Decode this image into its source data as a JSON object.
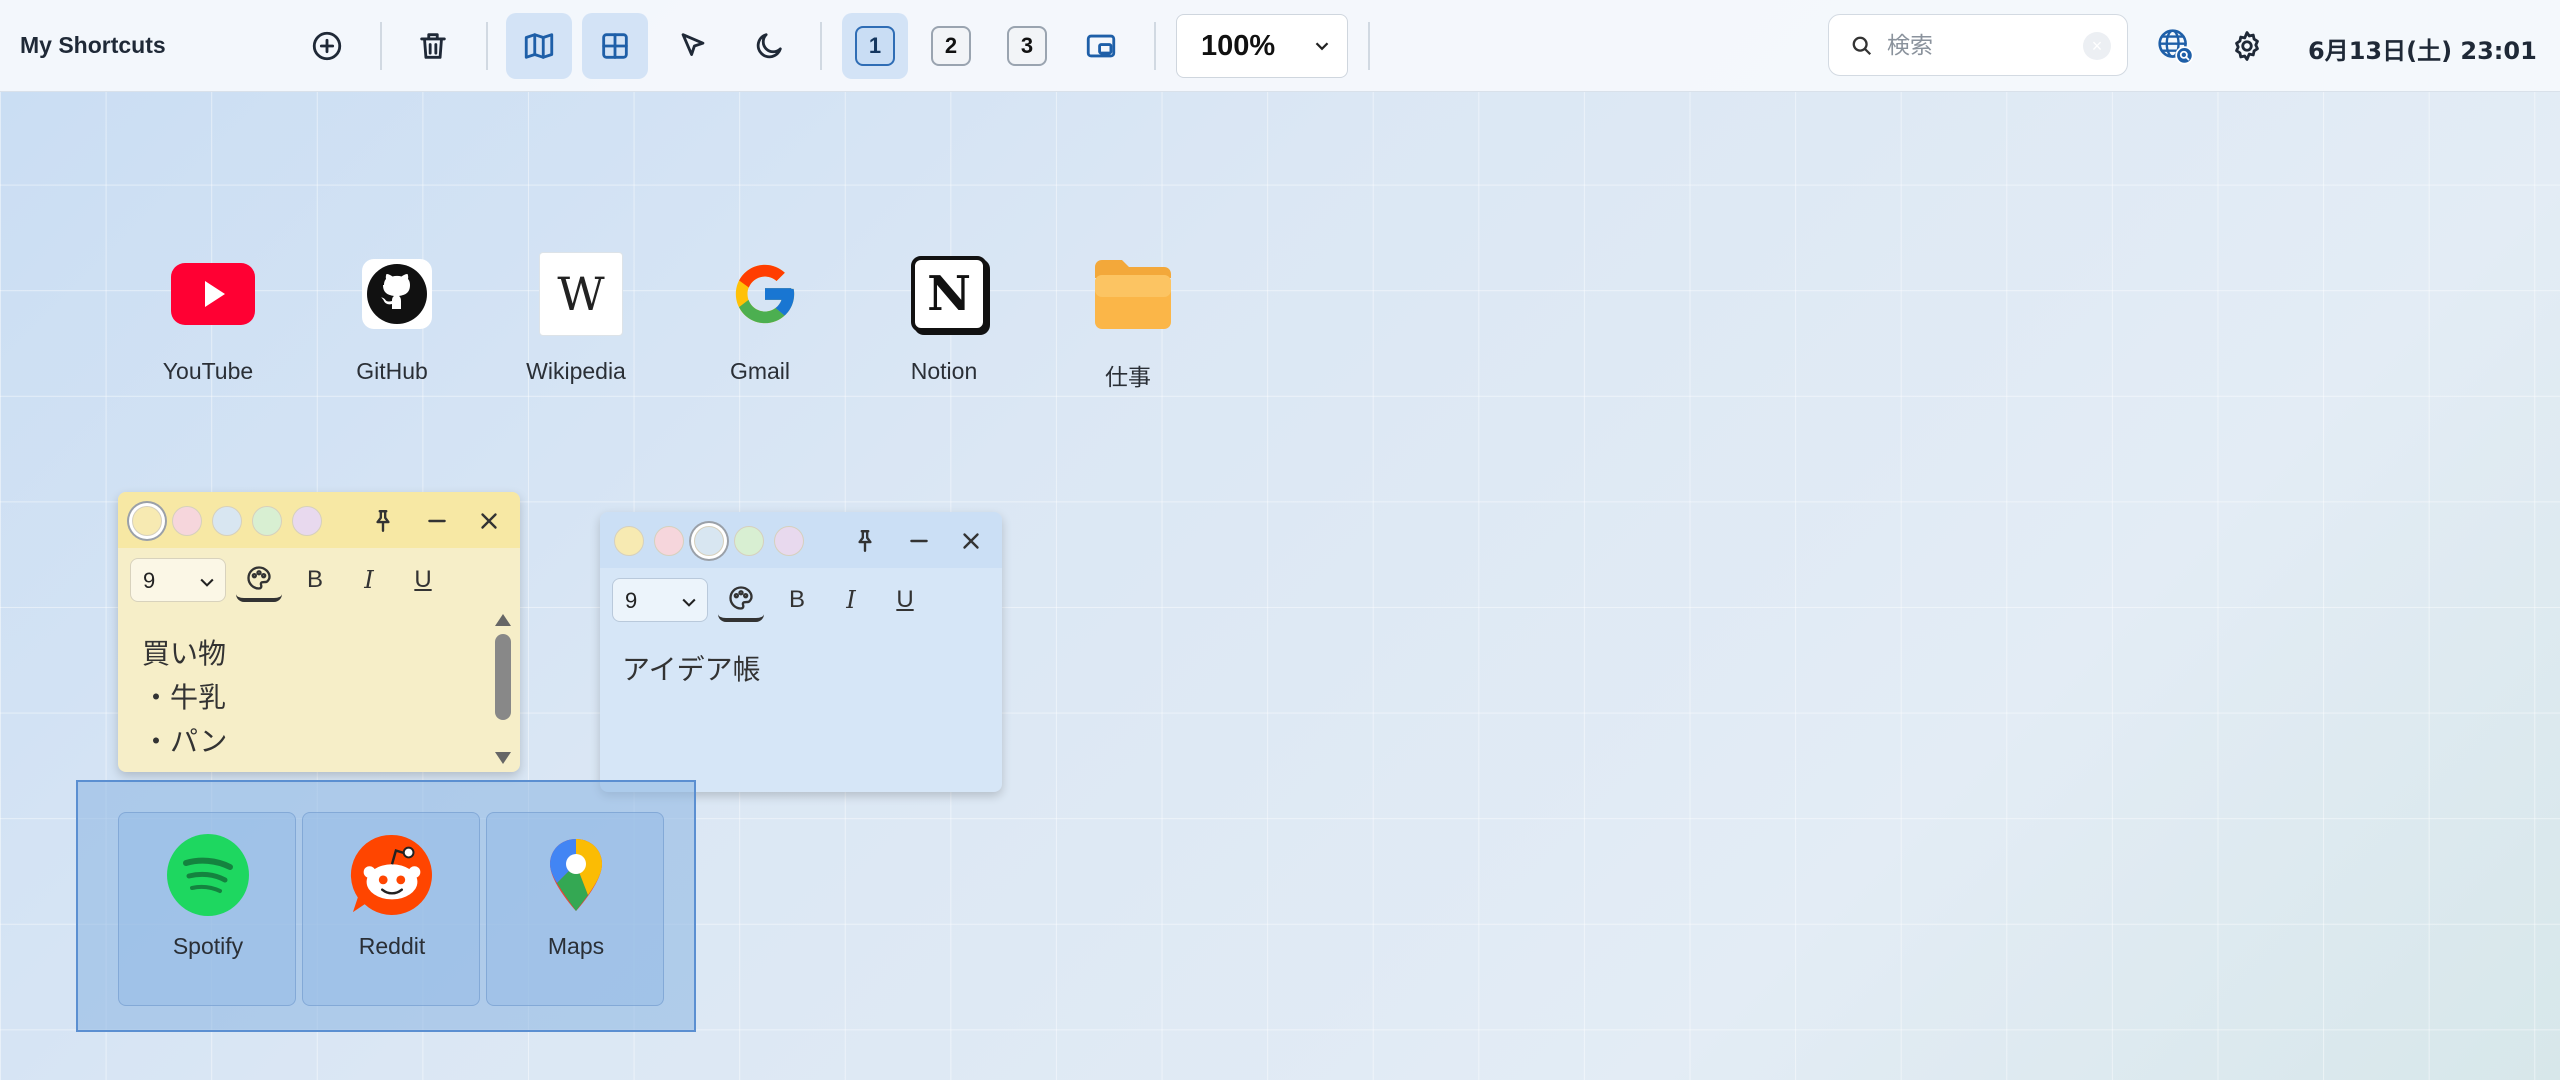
{
  "app": {
    "title": "My Shortcuts"
  },
  "toolbar": {
    "pages": [
      "1",
      "2",
      "3"
    ],
    "active_page": "1",
    "zoom": "100%",
    "search_placeholder": "検索",
    "datetime": "6月13日(土) 23:01"
  },
  "shortcuts": [
    {
      "label": "YouTube",
      "icon": "youtube-icon"
    },
    {
      "label": "GitHub",
      "icon": "github-icon"
    },
    {
      "label": "Wikipedia",
      "icon": "wikipedia-icon",
      "glyph": "W"
    },
    {
      "label": "Gmail",
      "icon": "google-icon"
    },
    {
      "label": "Notion",
      "icon": "notion-icon",
      "glyph": "N"
    },
    {
      "label": "仕事",
      "icon": "folder-icon"
    }
  ],
  "notes": [
    {
      "color": "#f6eec8",
      "font_size": "9",
      "content": "買い物\n・牛乳\n・パン",
      "tools": {
        "bold": "B",
        "italic": "I",
        "underline": "U"
      }
    },
    {
      "color": "#d6e6f7",
      "font_size": "9",
      "content": "アイデア帳",
      "tools": {
        "bold": "B",
        "italic": "I",
        "underline": "U"
      }
    }
  ],
  "swatch_colors": [
    "#f7eab2",
    "#f6d6dc",
    "#d8e6f1",
    "#d8efd2",
    "#e8d9ee"
  ],
  "group": {
    "items": [
      {
        "label": "Spotify",
        "icon": "spotify-icon"
      },
      {
        "label": "Reddit",
        "icon": "reddit-icon"
      },
      {
        "label": "Maps",
        "icon": "maps-pin-icon"
      }
    ]
  },
  "colors": {
    "accent": "#1e5fa8",
    "selection": "#5b8fd1"
  }
}
